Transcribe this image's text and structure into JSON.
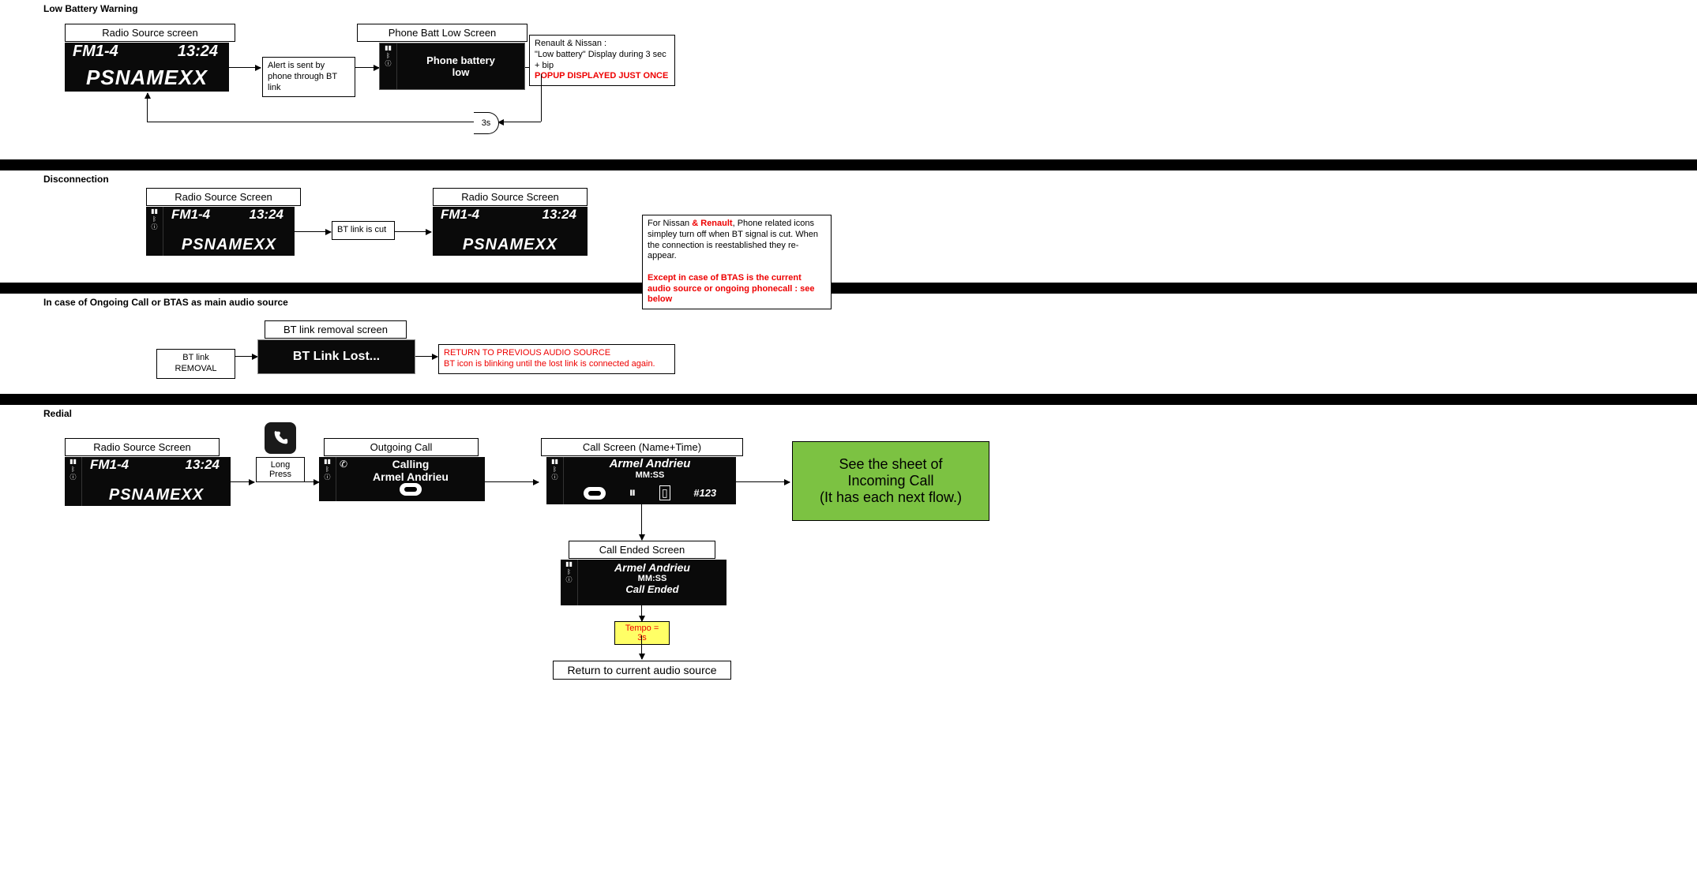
{
  "section1": {
    "title": "Low Battery Warning",
    "radio_label": "Radio Source screen",
    "fm": "FM1-4",
    "clock": "13:24",
    "ps": "PSNAMEXX",
    "alert_box": "Alert is sent by phone through BT link",
    "batt_label": "Phone Batt Low Screen",
    "batt_line1": "Phone battery",
    "batt_line2": "low",
    "note_l1": "Renault & Nissan :",
    "note_l2": "\"Low battery\" Display during 3 sec + bip",
    "note_red": "POPUP DISPLAYED JUST ONCE",
    "delay": "3s"
  },
  "section2": {
    "title": "Disconnection",
    "radio_label": "Radio Source Screen",
    "fm": "FM1-4",
    "clock": "13:24",
    "ps": "PSNAMEXX",
    "cut_box": "BT link is cut",
    "note_l1a": "For Nissan ",
    "note_l1b": "& Renault",
    "note_l1c": ", Phone related icons simpley turn off when BT signal is cut. When the connection is reestablished they re-appear.",
    "note_red": "Except in case of BTAS is the current audio source  or ongoing phonecall : see below"
  },
  "section3": {
    "title": "In case of Ongoing Call or BTAS as main audio source",
    "removal_box": "BT link REMOVAL",
    "screen_label": "BT link removal screen",
    "screen_text": "BT Link Lost...",
    "note_l1": "RETURN TO PREVIOUS AUDIO SOURCE",
    "note_l2": "BT icon is blinking until the lost link is connected again."
  },
  "section4": {
    "title": "Redial",
    "radio_label": "Radio Source Screen",
    "fm": "FM1-4",
    "clock": "13:24",
    "ps": "PSNAMEXX",
    "longpress": "Long Press",
    "out_label": "Outgoing Call",
    "calling_l1": "Calling",
    "calling_l2": "Armel Andrieu",
    "call_label": "Call Screen (Name+Time)",
    "call_name": "Armel Andrieu",
    "call_time": "MM:SS",
    "call_num": "#123",
    "green_l1": "See the sheet of",
    "green_l2": "Incoming Call",
    "green_l3": "(It has each next flow.)",
    "ended_label": "Call Ended Screen",
    "ended_name": "Armel Andrieu",
    "ended_time": "MM:SS",
    "ended_msg": "Call Ended",
    "tempo": "Tempo = 3s",
    "return_box": "Return to current audio source"
  },
  "icons": {
    "sig": "▮▮",
    "bt": "ᛒ",
    "info": "ⓘ"
  }
}
